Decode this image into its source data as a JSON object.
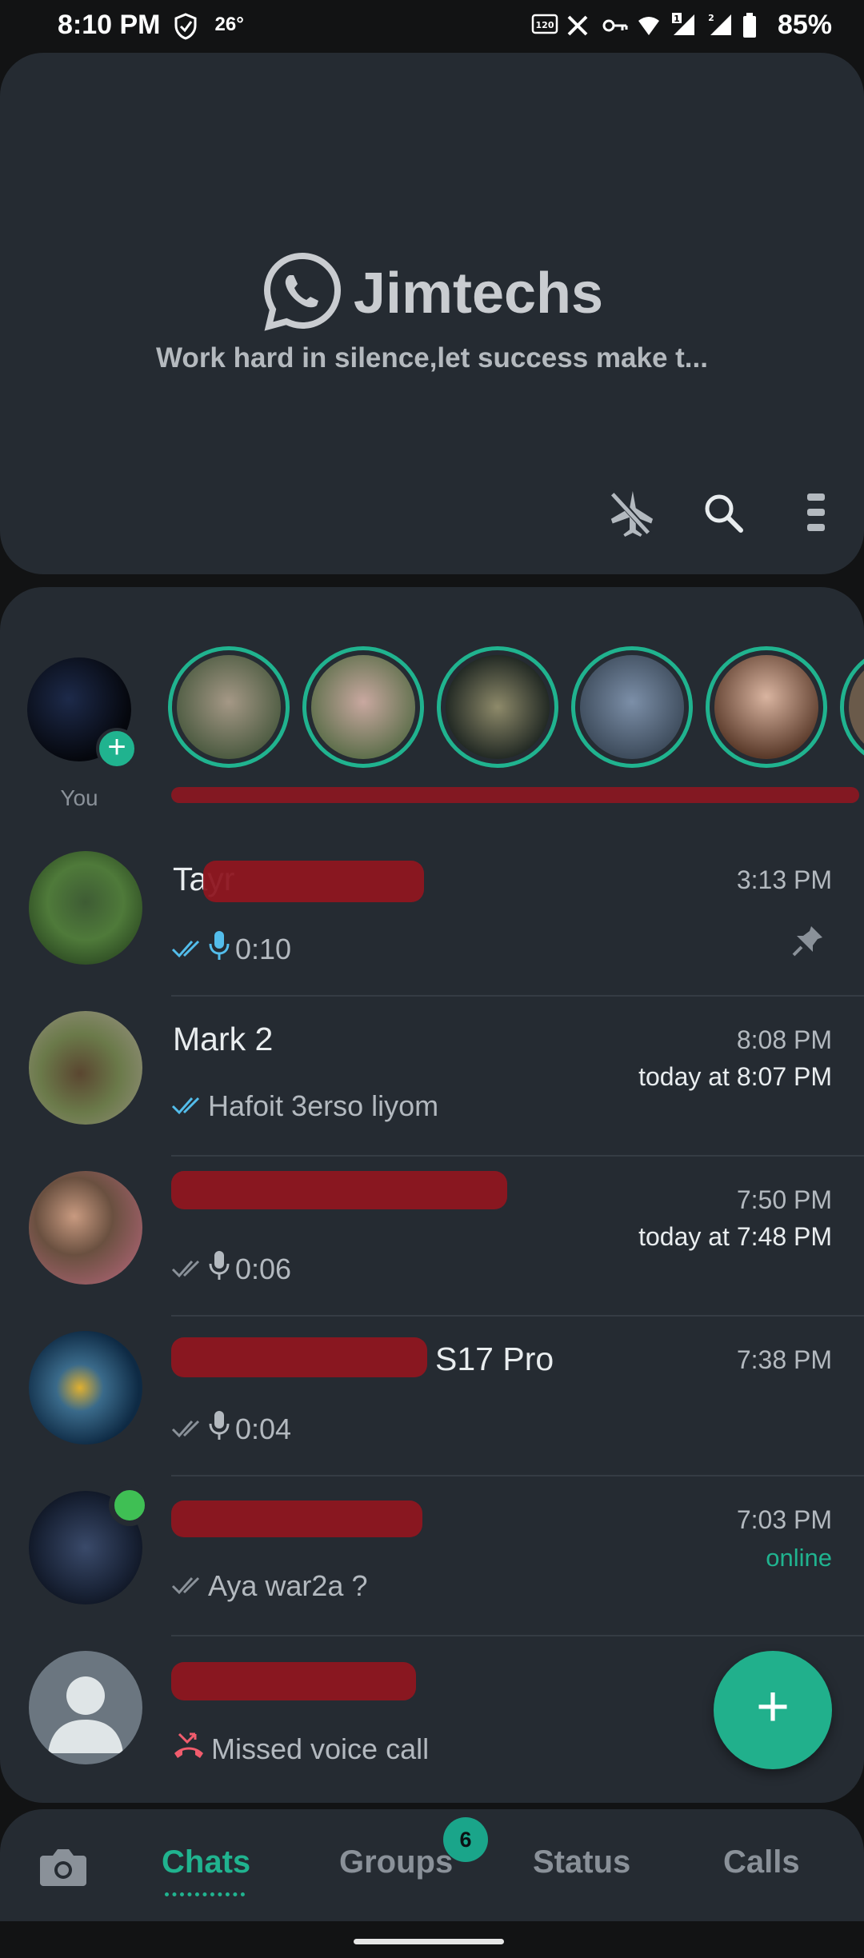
{
  "status_bar": {
    "time": "8:10 PM",
    "temperature": "26°",
    "battery": "85%",
    "icons": [
      "shield-check-icon",
      "120hz-icon",
      "x-icon",
      "vpn-key-icon",
      "wifi-icon",
      "signal-1-icon",
      "signal-2-icon",
      "battery-icon"
    ]
  },
  "header": {
    "brand_title": "Jimtechs",
    "subtitle": "Work hard in silence,let success make t...",
    "actions": [
      "airplane-mode-icon",
      "search-icon",
      "more-menu-icon"
    ]
  },
  "stories": {
    "you_label": "You",
    "items": [
      {
        "name": "",
        "color": "#8a7a6a"
      },
      {
        "name": "",
        "color": "#6b7a5a"
      },
      {
        "name": "",
        "color": "#3a4a3a"
      },
      {
        "name": "",
        "color": "#6a7b8c"
      },
      {
        "name": "",
        "color": "#b89a86"
      }
    ]
  },
  "chats": [
    {
      "name": "Tayr",
      "time": "3:13 PM",
      "subtime": "",
      "preview": "0:10",
      "type": "voice",
      "ticks": "read",
      "pinned": true
    },
    {
      "name": "Mark 2",
      "time": "8:08 PM",
      "subtime": "today at 8:07 PM",
      "preview": "Hafoit 3erso liyom",
      "type": "text",
      "ticks": "read",
      "pinned": false
    },
    {
      "name": "",
      "time": "7:50 PM",
      "subtime": "today at 7:48 PM",
      "preview": "0:06",
      "type": "voice",
      "ticks": "delivered",
      "pinned": false
    },
    {
      "name": "S17 Pro",
      "time": "7:38 PM",
      "subtime": "",
      "preview": "0:04",
      "type": "voice",
      "ticks": "delivered",
      "pinned": false
    },
    {
      "name": "",
      "time": "7:03 PM",
      "subtime": "online",
      "preview": "Aya war2a ?",
      "type": "text",
      "ticks": "delivered",
      "pinned": false
    },
    {
      "name": "",
      "time": "",
      "subtime": "",
      "preview": "Missed voice call",
      "type": "missed",
      "ticks": "",
      "pinned": false
    }
  ],
  "fab": {
    "label": "+"
  },
  "bottom_nav": {
    "camera": "camera-icon",
    "tabs": [
      "Chats",
      "Groups",
      "Status",
      "Calls"
    ],
    "active_tab": "Chats",
    "groups_badge": "6"
  },
  "colors": {
    "accent": "#20b38f",
    "surface": "#252b32",
    "background": "#121314",
    "read_tick": "#53bdeb"
  }
}
